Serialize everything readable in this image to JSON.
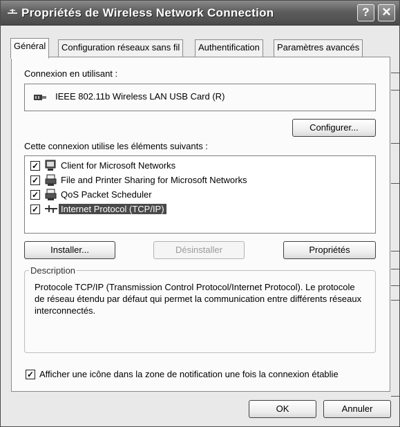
{
  "window": {
    "title": "Propriétés de Wireless Network Connection",
    "help_label": "?",
    "close_label": "✕"
  },
  "tabs": [
    {
      "label": "Général",
      "active": true
    },
    {
      "label": "Configuration réseaux sans fil",
      "active": false
    },
    {
      "label": "Authentification",
      "active": false
    },
    {
      "label": "Paramètres avancés",
      "active": false
    }
  ],
  "connection": {
    "label": "Connexion en utilisant :",
    "device": "IEEE 802.11b Wireless LAN USB Card (R)",
    "configure_label": "Configurer..."
  },
  "components": {
    "label": "Cette connexion utilise les éléments suivants :",
    "items": [
      {
        "label": "Client for Microsoft Networks",
        "checked": true,
        "icon": "network-client-icon",
        "selected": false
      },
      {
        "label": "File and Printer Sharing for Microsoft Networks",
        "checked": true,
        "icon": "file-printer-sharing-icon",
        "selected": false
      },
      {
        "label": "QoS Packet Scheduler",
        "checked": true,
        "icon": "packet-scheduler-icon",
        "selected": false
      },
      {
        "label": "Internet Protocol (TCP/IP)",
        "checked": true,
        "icon": "protocol-icon",
        "selected": true
      }
    ]
  },
  "actions": {
    "install_label": "Installer...",
    "uninstall_label": "Désinstaller",
    "properties_label": "Propriétés"
  },
  "description": {
    "legend": "Description",
    "text": "Protocole TCP/IP (Transmission Control Protocol/Internet Protocol). Le protocole de réseau étendu par défaut qui permet la communication entre différents réseaux interconnectés."
  },
  "notify": {
    "checked": true,
    "label": "Afficher une icône dans la zone de notification une fois la connexion établie"
  },
  "footer": {
    "ok_label": "OK",
    "cancel_label": "Annuler"
  }
}
